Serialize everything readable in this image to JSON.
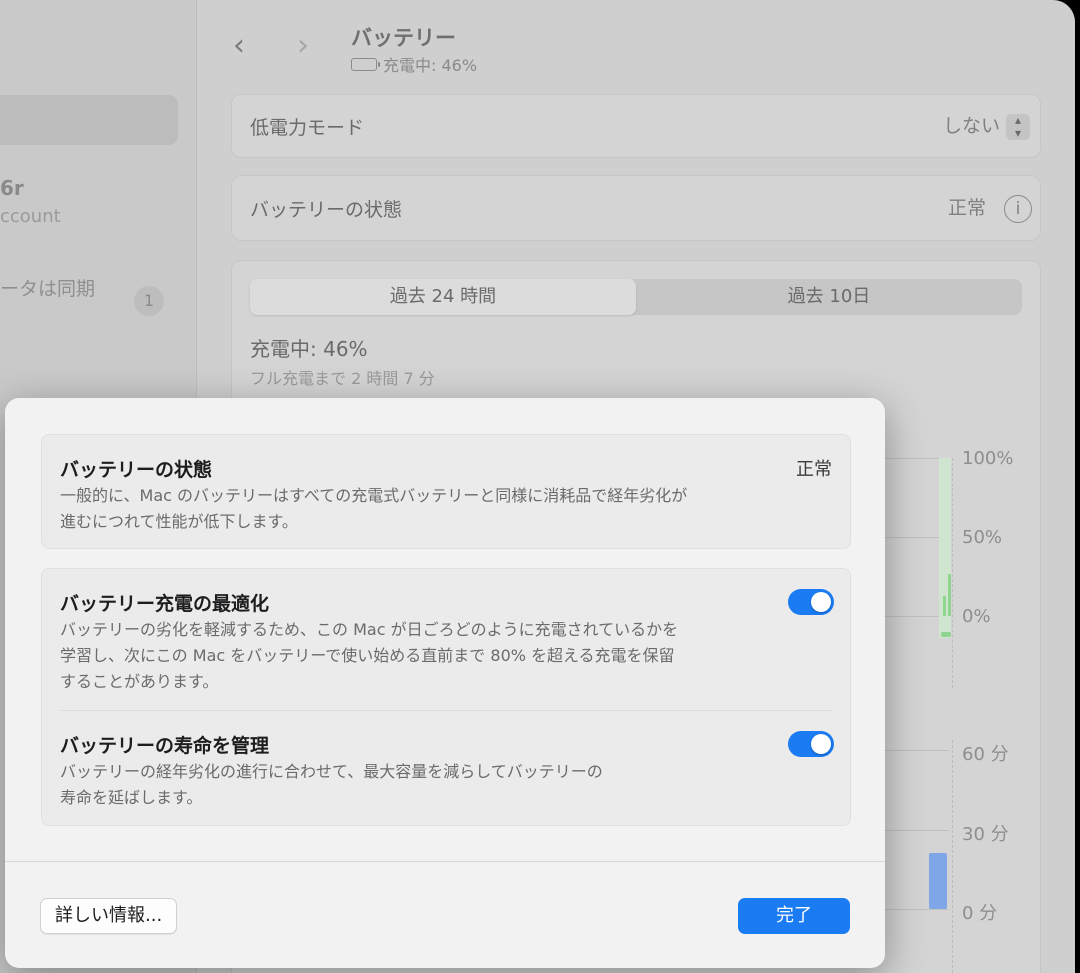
{
  "sidebar": {
    "account_name": "6r",
    "account_sub": "ccount",
    "sync_text": "ータは同期",
    "badge": "1"
  },
  "header": {
    "back": "‹",
    "forward": "›",
    "title": "バッテリー",
    "status": "充電中: 46%"
  },
  "settings": {
    "low_power_label": "低電力モード",
    "low_power_value": "しない",
    "health_label": "バッテリーの状態",
    "health_value": "正常",
    "info_glyph": "i"
  },
  "usage": {
    "tabs": [
      "過去 24 時間",
      "過去 10日"
    ],
    "charging": "充電中: 46%",
    "time_to_full": "フル充電まで 2 時間 7 分"
  },
  "chart_data": [
    {
      "type": "bar",
      "ytick_labels": [
        "100%",
        "50%",
        "0%"
      ],
      "ylim": [
        0,
        100
      ]
    },
    {
      "type": "bar",
      "ytick_labels": [
        "60 分",
        "30 分",
        "0 分"
      ],
      "ylim": [
        0,
        60
      ],
      "values": [
        21
      ]
    }
  ],
  "dialog": {
    "health": {
      "title": "バッテリーの状態",
      "status": "正常",
      "desc_line1": "一般的に、Mac のバッテリーはすべての充電式バッテリーと同様に消耗品で経年劣化が",
      "desc_line2": "進むにつれて性能が低下します。"
    },
    "optimize": {
      "title": "バッテリー充電の最適化",
      "enabled": true,
      "desc_line1": "バッテリーの劣化を軽減するため、この Mac が日ごろどのように充電されているかを",
      "desc_line2": "学習し、次にこの Mac をバッテリーで使い始める直前まで 80% を超える充電を保留",
      "desc_line3": "することがあります。"
    },
    "lifespan": {
      "title": "バッテリーの寿命を管理",
      "enabled": true,
      "desc_line1": "バッテリーの経年劣化の進行に合わせて、最大容量を減らしてバッテリーの",
      "desc_line2": "寿命を延ばします。"
    },
    "more_info_button": "詳しい情報...",
    "done_button": "完了"
  },
  "colors": {
    "accent": "#1a7bf2",
    "chart_green": "#8fd48f",
    "chart_blue": "#7fa6e6"
  }
}
